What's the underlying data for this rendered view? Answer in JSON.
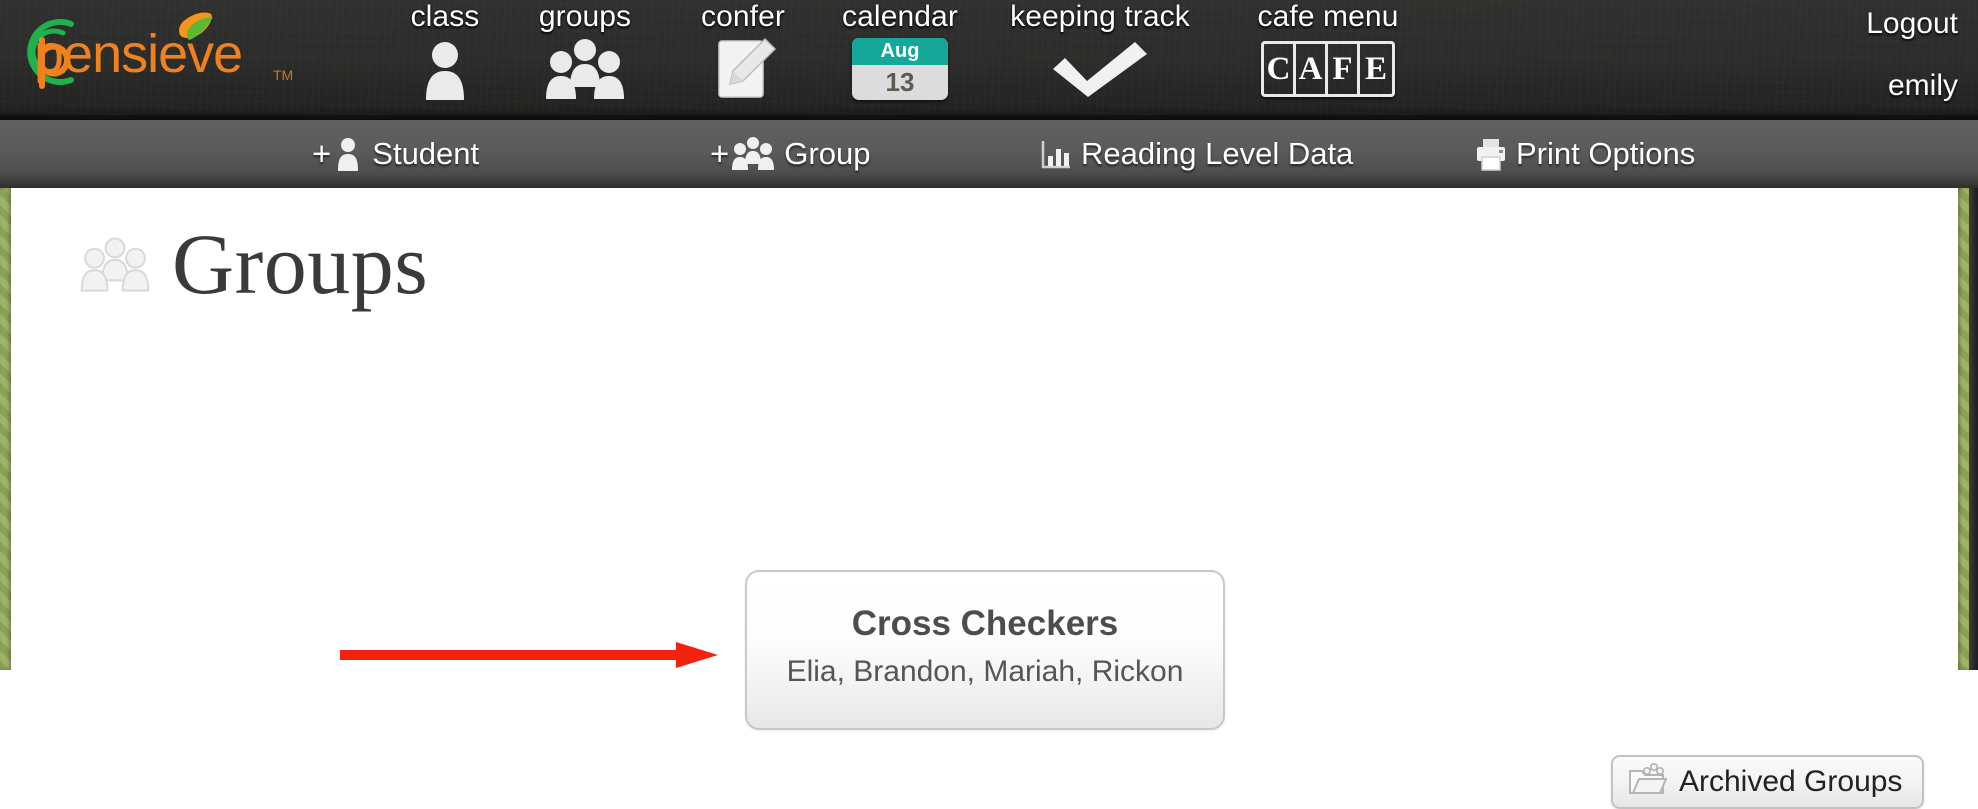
{
  "brand": {
    "name": "pensieve",
    "trademark": "TM",
    "colors": {
      "orange": "#f0821e",
      "green": "#1fb14b",
      "leaf_green": "#5cb82e"
    }
  },
  "header": {
    "nav": [
      {
        "label": "class",
        "icon": "person-icon"
      },
      {
        "label": "groups",
        "icon": "people-group-icon"
      },
      {
        "label": "confer",
        "icon": "note-pencil-icon"
      },
      {
        "label": "calendar",
        "icon": "calendar-icon",
        "month": "Aug",
        "day": "13"
      },
      {
        "label": "keeping track",
        "icon": "checkmark-icon"
      },
      {
        "label": "cafe menu",
        "icon": "cafe-icon",
        "cells": [
          "C",
          "A",
          "F",
          "E"
        ]
      }
    ],
    "account": {
      "logout_label": "Logout",
      "username": "emily"
    },
    "accent_teal": "#14a79a"
  },
  "toolbar": {
    "items": [
      {
        "label": "Student",
        "icon": "add-student-icon",
        "prefix": "+"
      },
      {
        "label": "Group",
        "icon": "add-group-icon",
        "prefix": "+"
      },
      {
        "label": "Reading Level Data",
        "icon": "bar-chart-icon",
        "prefix": ""
      },
      {
        "label": "Print Options",
        "icon": "printer-icon",
        "prefix": ""
      }
    ]
  },
  "page": {
    "title": "Groups",
    "title_icon": "people-group-icon"
  },
  "groups": [
    {
      "name": "Cross Checkers",
      "members": "Elia, Brandon, Mariah, Rickon"
    }
  ],
  "archived_button": {
    "label": "Archived Groups",
    "icon": "archive-folder-icon"
  },
  "annotation": {
    "type": "arrow",
    "color": "#f42111",
    "direction": "right"
  }
}
